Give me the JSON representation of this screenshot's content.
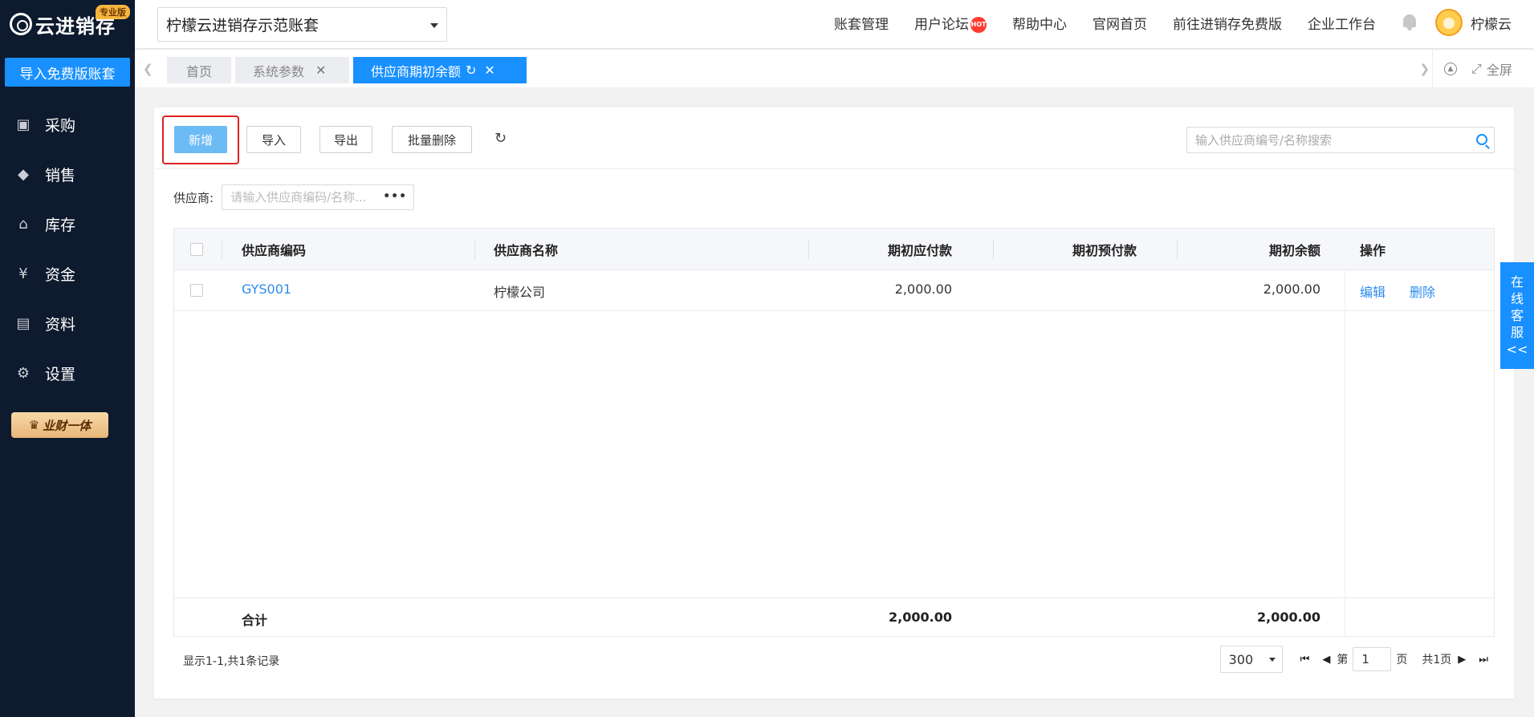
{
  "sidebar": {
    "logo_text": "云进销存",
    "pro_badge": "专业版",
    "import_button": "导入免费版账套",
    "items": [
      {
        "label": "采购",
        "icon": "shopping-bag-icon"
      },
      {
        "label": "销售",
        "icon": "sales-tag-icon"
      },
      {
        "label": "库存",
        "icon": "warehouse-icon"
      },
      {
        "label": "资金",
        "icon": "yen-icon"
      },
      {
        "label": "资料",
        "icon": "document-icon"
      },
      {
        "label": "设置",
        "icon": "gear-icon"
      }
    ],
    "yecai_label": "业财一体"
  },
  "header": {
    "account_select": "柠檬云进销存示范账套",
    "links": [
      "账套管理",
      "用户论坛",
      "帮助中心",
      "官网首页",
      "前往进销存免费版",
      "企业工作台"
    ],
    "hot_badge": "HOT",
    "user_name": "柠檬云"
  },
  "tabs": {
    "home": "首页",
    "system_params": "系统参数",
    "active": "供应商期初余额",
    "fullscreen": "全屏"
  },
  "toolbar": {
    "add": "新增",
    "import": "导入",
    "export": "导出",
    "batch_delete": "批量删除",
    "search_placeholder": "输入供应商编号/名称搜索"
  },
  "filter": {
    "label": "供应商:",
    "placeholder": "请输入供应商编码/名称..."
  },
  "table": {
    "columns": [
      "供应商编码",
      "供应商名称",
      "期初应付款",
      "期初预付款",
      "期初余额",
      "操作"
    ],
    "rows": [
      {
        "code": "GYS001",
        "name": "柠檬公司",
        "payable": "2,000.00",
        "prepaid": "",
        "balance": "2,000.00",
        "edit": "编辑",
        "delete": "删除"
      }
    ],
    "total_label": "合计",
    "total_payable": "2,000.00",
    "total_balance": "2,000.00"
  },
  "pager": {
    "summary": "显示1-1,共1条记录",
    "page_size": "300",
    "page_prefix": "第",
    "page_number": "1",
    "page_suffix": "页",
    "total_pages": "共1页"
  },
  "kefu": [
    "在",
    "线",
    "客",
    "服",
    "<<"
  ],
  "colors": {
    "primary": "#1890ff",
    "sidebar_bg": "#0e1a2e",
    "highlight_red": "#e02020",
    "link_blue": "#2d8cf0"
  }
}
